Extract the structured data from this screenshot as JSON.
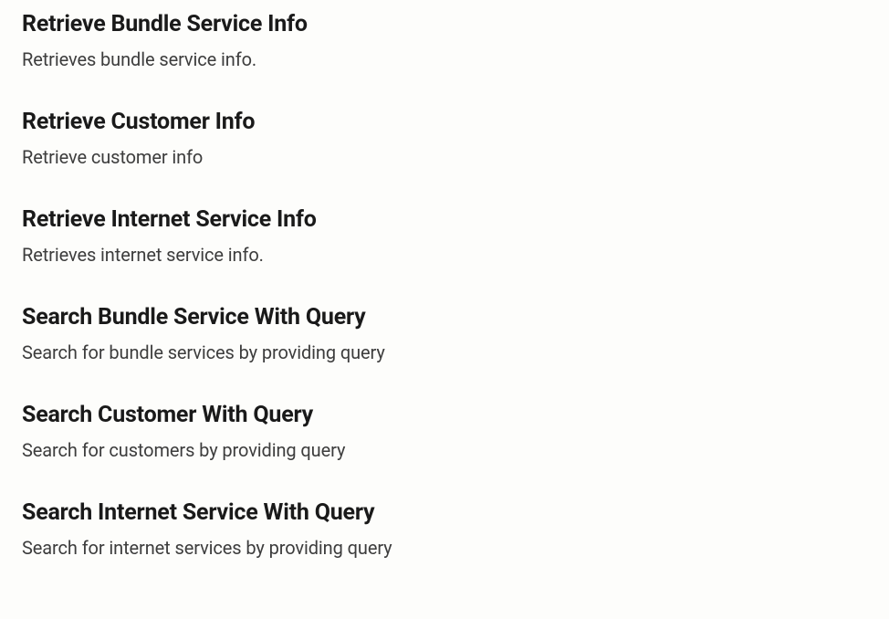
{
  "items": [
    {
      "title": "Retrieve Bundle Service Info",
      "description": "Retrieves bundle service info."
    },
    {
      "title": "Retrieve Customer Info",
      "description": "Retrieve customer info"
    },
    {
      "title": "Retrieve Internet Service Info",
      "description": "Retrieves internet service info."
    },
    {
      "title": "Search Bundle Service With Query",
      "description": "Search for bundle services by providing query"
    },
    {
      "title": "Search Customer With Query",
      "description": "Search for customers by providing query"
    },
    {
      "title": "Search Internet Service With Query",
      "description": "Search for internet services by providing query"
    }
  ]
}
